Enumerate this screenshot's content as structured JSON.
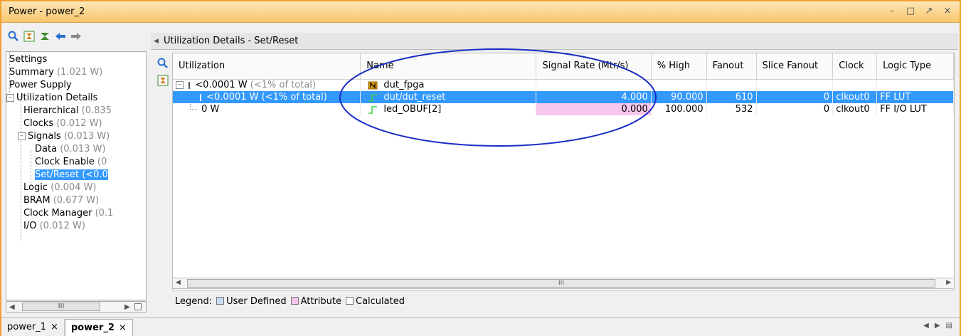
{
  "window": {
    "title": "Power - power_2"
  },
  "left_tree": {
    "items": [
      {
        "label": "Settings",
        "value": ""
      },
      {
        "label": "Summary",
        "value": "(1.021 W)"
      },
      {
        "label": "Power Supply",
        "value": ""
      },
      {
        "label": "Utilization Details",
        "value": ""
      },
      {
        "label": "Hierarchical",
        "value": "(0.835"
      },
      {
        "label": "Clocks",
        "value": "(0.012 W)"
      },
      {
        "label": "Signals",
        "value": "(0.013 W)"
      },
      {
        "label": "Data",
        "value": "(0.013 W)"
      },
      {
        "label": "Clock Enable",
        "value": "(0"
      },
      {
        "label": "Set/Reset",
        "value": "(<0.0"
      },
      {
        "label": "Logic",
        "value": "(0.004 W)"
      },
      {
        "label": "BRAM",
        "value": "(0.677 W)"
      },
      {
        "label": "Clock Manager",
        "value": "(0.1"
      },
      {
        "label": "I/O",
        "value": "(0.012 W)"
      }
    ],
    "scroll_thumb": "III"
  },
  "section_title": "Utilization Details - Set/Reset",
  "table": {
    "headers": [
      "Utilization",
      "Name",
      "Signal Rate (Mtr/s)",
      "% High",
      "Fanout",
      "Slice Fanout",
      "Clock",
      "Logic Type"
    ],
    "rows": [
      {
        "util": "<0.0001 W",
        "util_dim": "(<1% of total)",
        "name": "dut_fpga",
        "rate": "",
        "high": "",
        "fanout": "",
        "slice": "",
        "clock": "",
        "logic": ""
      },
      {
        "util": "<0.0001 W (<1% of total)",
        "util_dim": "",
        "name": "dut/dut_reset",
        "rate": "4.000",
        "high": "90.000",
        "fanout": "610",
        "slice": "0",
        "clock": "clkout0",
        "logic": "FF LUT"
      },
      {
        "util": "0 W",
        "util_dim": "",
        "name": "led_OBUF[2]",
        "rate": "0.000",
        "high": "100.000",
        "fanout": "532",
        "slice": "0",
        "clock": "clkout0",
        "logic": "FF I/O LUT"
      }
    ],
    "scroll_thumb": "III"
  },
  "legend": {
    "label": "Legend:",
    "items": [
      {
        "label": "User Defined",
        "color": "#c9dcf5"
      },
      {
        "label": "Attribute",
        "color": "#f6c6ec"
      },
      {
        "label": "Calculated",
        "color": "#ffffff"
      }
    ]
  },
  "tabs": [
    {
      "label": "power_1",
      "active": false
    },
    {
      "label": "power_2",
      "active": true
    }
  ],
  "colors": {
    "selection": "#3399ff",
    "title_bar": "#f7c66c",
    "annotation": "#1a2cc4"
  }
}
